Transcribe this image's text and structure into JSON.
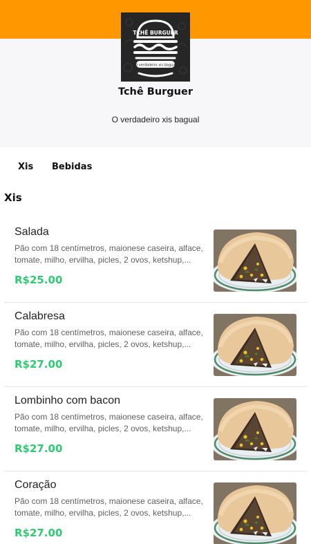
{
  "header": {
    "store_name": "Tchê Burguer",
    "tagline": "O verdadeiro xis bagual",
    "logo_icon": "burger-logo-icon",
    "logo_lettering_top": "TCHÊ BURGUER",
    "logo_lettering_bottom": "O verdadeiro xis bagual",
    "accent_color": "#ff9800"
  },
  "tabs": [
    {
      "label": "Xis"
    },
    {
      "label": "Bebidas"
    }
  ],
  "section": {
    "title": "Xis"
  },
  "price_color": "#2ecc71",
  "items": [
    {
      "name": "Salada",
      "description": "Pão com 18 centímetros, maionese caseira, alface, tomate, milho, ervilha, picles, 2 ovos, ketshup,...",
      "price": "R$25.00",
      "photo": "burger-photo"
    },
    {
      "name": "Calabresa",
      "description": "Pão com 18 centímetros, maionese caseira, alface, tomate, milho, ervilha, picles, 2 ovos, ketshup,...",
      "price": "R$27.00",
      "photo": "burger-photo"
    },
    {
      "name": "Lombinho com bacon",
      "description": "Pão com 18 centímetros, maionese caseira, alface, tomate, milho, ervilha, picles, 2 ovos, ketshup,...",
      "price": "R$27.00",
      "photo": "burger-photo"
    },
    {
      "name": "Coração",
      "description": "Pão com 18 centímetros, maionese caseira, alface, tomate, milho, ervilha, picles, 2 ovos, ketshup,...",
      "price": "R$27.00",
      "photo": "burger-photo"
    }
  ]
}
